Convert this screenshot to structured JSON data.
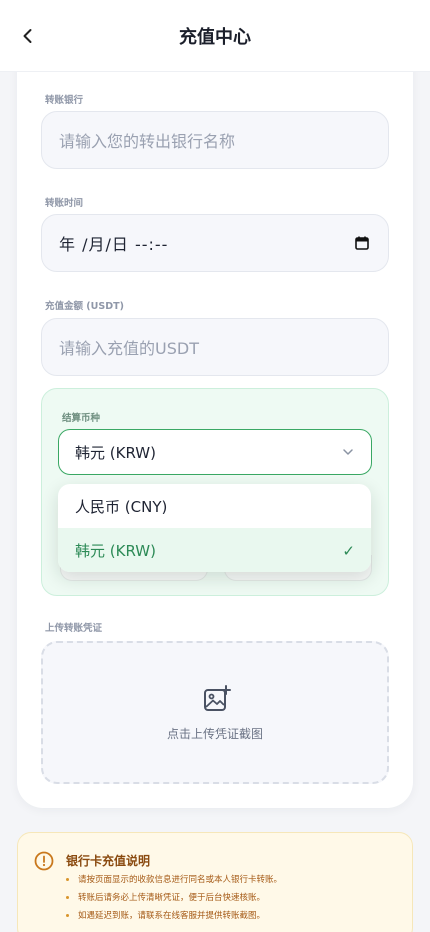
{
  "header": {
    "title": "充值中心"
  },
  "form": {
    "bank": {
      "label": "转账银行",
      "placeholder": "请输入您的转出银行名称"
    },
    "time": {
      "label": "转账时间",
      "value": "年 /月/日 --:--"
    },
    "amount": {
      "label": "充值金额 (USDT)",
      "placeholder": "请输入充值的USDT"
    },
    "settlement": {
      "label": "结算币种",
      "selected": "韩元 (KRW)",
      "options": [
        {
          "label": "人民币 (CNY)",
          "selected": false
        },
        {
          "label": "韩元 (KRW)",
          "selected": true
        }
      ],
      "check_glyph": "✓"
    },
    "upload": {
      "label": "上传转账凭证",
      "text": "点击上传凭证截图"
    }
  },
  "notice": {
    "title": "银行卡充值说明",
    "items": [
      "请按页面显示的收款信息进行同名或本人银行卡转账。",
      "转账后请务必上传清晰凭证，便于后台快速核账。",
      "如遇延迟到账，请联系在线客服并提供转账截图。"
    ]
  },
  "icons": {
    "back": "chevron-left-icon",
    "calendar": "calendar-icon",
    "dropdown": "chevron-down-icon",
    "upload": "image-add-icon",
    "notice": "warning-circle-icon"
  },
  "colors": {
    "accent_green": "#3aa864",
    "selected_text": "#2c8a56",
    "notice_bg": "#fff9e8",
    "notice_text": "#a55a16"
  }
}
